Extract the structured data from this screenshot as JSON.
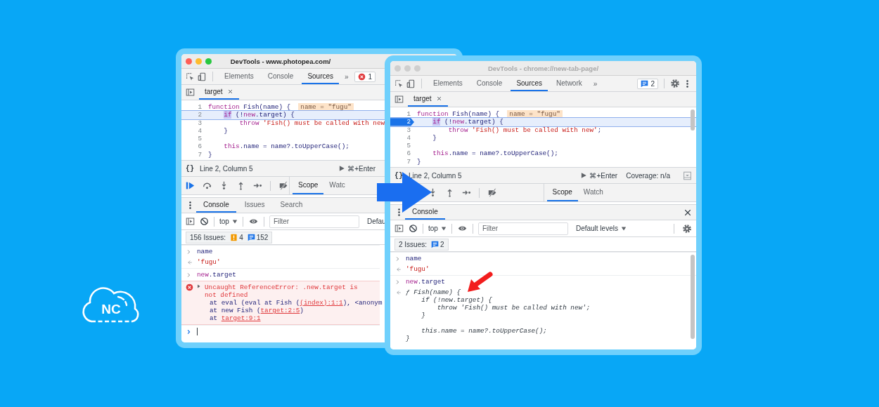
{
  "logo": {
    "text": "NC"
  },
  "windows": [
    {
      "title": "DevTools - www.photopea.com/",
      "focused": true,
      "panel_tabs": [
        {
          "label": "Elements",
          "selected": false
        },
        {
          "label": "Console",
          "selected": false
        },
        {
          "label": "Sources",
          "selected": true
        }
      ],
      "more_tabs": "»",
      "issue_badge": {
        "kind": "error",
        "count": "1"
      },
      "file_tabs": [
        {
          "label": "target",
          "selected": true
        }
      ],
      "code_lines": [
        {
          "number": "1",
          "paused": false,
          "breakpoint": false,
          "segments": [
            {
              "kind": "keyword",
              "text": "function"
            },
            {
              "kind": "plain",
              "text": " Fish(name) {  "
            },
            {
              "kind": "value",
              "text": "name = \"fugu\""
            }
          ],
          "children": [
            {
              "number": "2",
              "paused": true,
              "breakpoint": false,
              "segments": [
                {
                  "kind": "current",
                  "text": "if"
                },
                {
                  "kind": "plain",
                  "text": " (!"
                },
                {
                  "kind": "keyword",
                  "text": "new"
                },
                {
                  "kind": "plain",
                  "text": ".target) {"
                }
              ],
              "children": [
                {
                  "number": "3",
                  "paused": false,
                  "breakpoint": false,
                  "segments": [
                    {
                      "kind": "keyword",
                      "text": "throw "
                    },
                    {
                      "kind": "string",
                      "text": "'Fish() must be called with new"
                    }
                  ]
                }
              ]
            },
            {
              "number": "4",
              "paused": false,
              "breakpoint": false,
              "segments": [
                {
                  "kind": "plain",
                  "text": "}"
                }
              ]
            },
            {
              "number": "5",
              "paused": false,
              "breakpoint": false
            },
            {
              "number": "6",
              "paused": false,
              "breakpoint": false,
              "segments": [
                {
                  "kind": "keyword",
                  "text": "this"
                },
                {
                  "kind": "plain",
                  "text": ".name = name?.toUpperCase();"
                }
              ]
            }
          ]
        },
        {
          "number": "7",
          "paused": false,
          "breakpoint": false,
          "segments": [
            {
              "kind": "plain",
              "text": "}"
            }
          ]
        }
      ],
      "pretty_print": "{}",
      "cursor_position": "Line 2, Column 5",
      "run_shortcut": "⌘+Enter",
      "sidebar_tabs": [
        {
          "label": "Scope",
          "selected": true
        },
        {
          "label": "Watc",
          "selected": false
        }
      ],
      "drawer_tabs": [
        {
          "label": "Console",
          "selected": true
        },
        {
          "label": "Issues",
          "selected": false
        },
        {
          "label": "Search",
          "selected": false
        }
      ],
      "context": "top",
      "filter_placeholder": "Filter",
      "levels": {
        "label": "Defau",
        "caret": false
      },
      "issues": {
        "label": "156 Issues:",
        "counts": [
          {
            "kind": "warning",
            "count": "4"
          },
          {
            "kind": "info",
            "count": "152"
          }
        ]
      },
      "messages": [
        {
          "kind": "input",
          "segments": [
            {
              "kind": "plain",
              "text": "name"
            }
          ]
        },
        {
          "kind": "result",
          "segments": [
            {
              "kind": "string",
              "text": "'fugu'"
            }
          ]
        },
        {
          "kind": "input",
          "segments": [
            {
              "kind": "keyword",
              "text": "new"
            },
            {
              "kind": "plain",
              "text": ".target"
            }
          ]
        },
        {
          "kind": "error",
          "text": "Uncaught ReferenceError: .new.target is not defined",
          "stack": [
            [
              {
                "kind": "plain",
                "text": "at eval (eval at Fish ("
              },
              {
                "kind": "link",
                "text": "(index):1:1"
              },
              {
                "kind": "plain",
                "text": "), <anonym"
              }
            ],
            [
              {
                "kind": "plain",
                "text": "at new Fish ("
              },
              {
                "kind": "link",
                "text": "target:2:5"
              },
              {
                "kind": "plain",
                "text": ")"
              }
            ],
            [
              {
                "kind": "plain",
                "text": "at "
              },
              {
                "kind": "link",
                "text": "target:9:1"
              }
            ]
          ]
        },
        {
          "kind": "prompt"
        }
      ]
    },
    {
      "title": "DevTools - chrome://new-tab-page/",
      "focused": false,
      "panel_tabs": [
        {
          "label": "Elements",
          "selected": false
        },
        {
          "label": "Console",
          "selected": false
        },
        {
          "label": "Sources",
          "selected": true
        },
        {
          "label": "Network",
          "selected": false
        }
      ],
      "more_tabs": "»",
      "issue_badge": {
        "kind": "info",
        "count": "2"
      },
      "settings_menu": true,
      "file_tabs": [
        {
          "label": "target",
          "selected": true
        }
      ],
      "code_lines": [
        {
          "number": "1",
          "paused": false,
          "breakpoint": false,
          "segments": [
            {
              "kind": "keyword",
              "text": "function"
            },
            {
              "kind": "plain",
              "text": " Fish(name) {  "
            },
            {
              "kind": "value",
              "text": "name = \"fugu\""
            }
          ],
          "children": [
            {
              "number": "2",
              "paused": true,
              "breakpoint": true,
              "segments": [
                {
                  "kind": "current",
                  "text": "if"
                },
                {
                  "kind": "plain",
                  "text": " (!"
                },
                {
                  "kind": "keyword",
                  "text": "new"
                },
                {
                  "kind": "plain",
                  "text": ".target) {"
                }
              ],
              "children": [
                {
                  "number": "3",
                  "paused": false,
                  "breakpoint": false,
                  "segments": [
                    {
                      "kind": "keyword",
                      "text": "throw "
                    },
                    {
                      "kind": "string",
                      "text": "'Fish() must be called with new'"
                    },
                    {
                      "kind": "plain",
                      "text": ";"
                    }
                  ]
                }
              ]
            },
            {
              "number": "4",
              "paused": false,
              "breakpoint": false,
              "segments": [
                {
                  "kind": "plain",
                  "text": "}"
                }
              ]
            },
            {
              "number": "5",
              "paused": false,
              "breakpoint": false
            },
            {
              "number": "6",
              "paused": false,
              "breakpoint": false,
              "segments": [
                {
                  "kind": "keyword",
                  "text": "this"
                },
                {
                  "kind": "plain",
                  "text": ".name = name?.toUpperCase();"
                }
              ]
            }
          ]
        },
        {
          "number": "7",
          "paused": false,
          "breakpoint": false,
          "segments": [
            {
              "kind": "plain",
              "text": "}"
            }
          ]
        }
      ],
      "pretty_print": "{}",
      "cursor_position": "Line 2, Column 5",
      "run_shortcut": "⌘+Enter",
      "coverage": "Coverage: n/a",
      "sidebar_tabs": [
        {
          "label": "Scope",
          "selected": true
        },
        {
          "label": "Watch",
          "selected": false
        }
      ],
      "drawer_tabs": [
        {
          "label": "Console",
          "selected": true
        }
      ],
      "drawer_close": true,
      "context": "top",
      "filter_placeholder": "Filter",
      "levels": {
        "label": "Default levels",
        "caret": true
      },
      "console_settings": true,
      "issues": {
        "label": "2 Issues:",
        "counts": [
          {
            "kind": "info",
            "count": "2"
          }
        ]
      },
      "scrollbars": true,
      "messages": [
        {
          "kind": "input",
          "segments": [
            {
              "kind": "plain",
              "text": "name"
            }
          ]
        },
        {
          "kind": "result",
          "segments": [
            {
              "kind": "string",
              "text": "'fugu'"
            }
          ]
        },
        {
          "kind": "input",
          "segments": [
            {
              "kind": "keyword",
              "text": "new"
            },
            {
              "kind": "plain",
              "text": ".target"
            }
          ]
        },
        {
          "kind": "function",
          "blocks": [
            [
              "ƒ Fish(name) {",
              "    if (!new.target) {",
              "        throw 'Fish() must be called with new';",
              "    }"
            ],
            [
              "    this.name = name?.toUpperCase();",
              "}"
            ]
          ]
        }
      ]
    }
  ]
}
